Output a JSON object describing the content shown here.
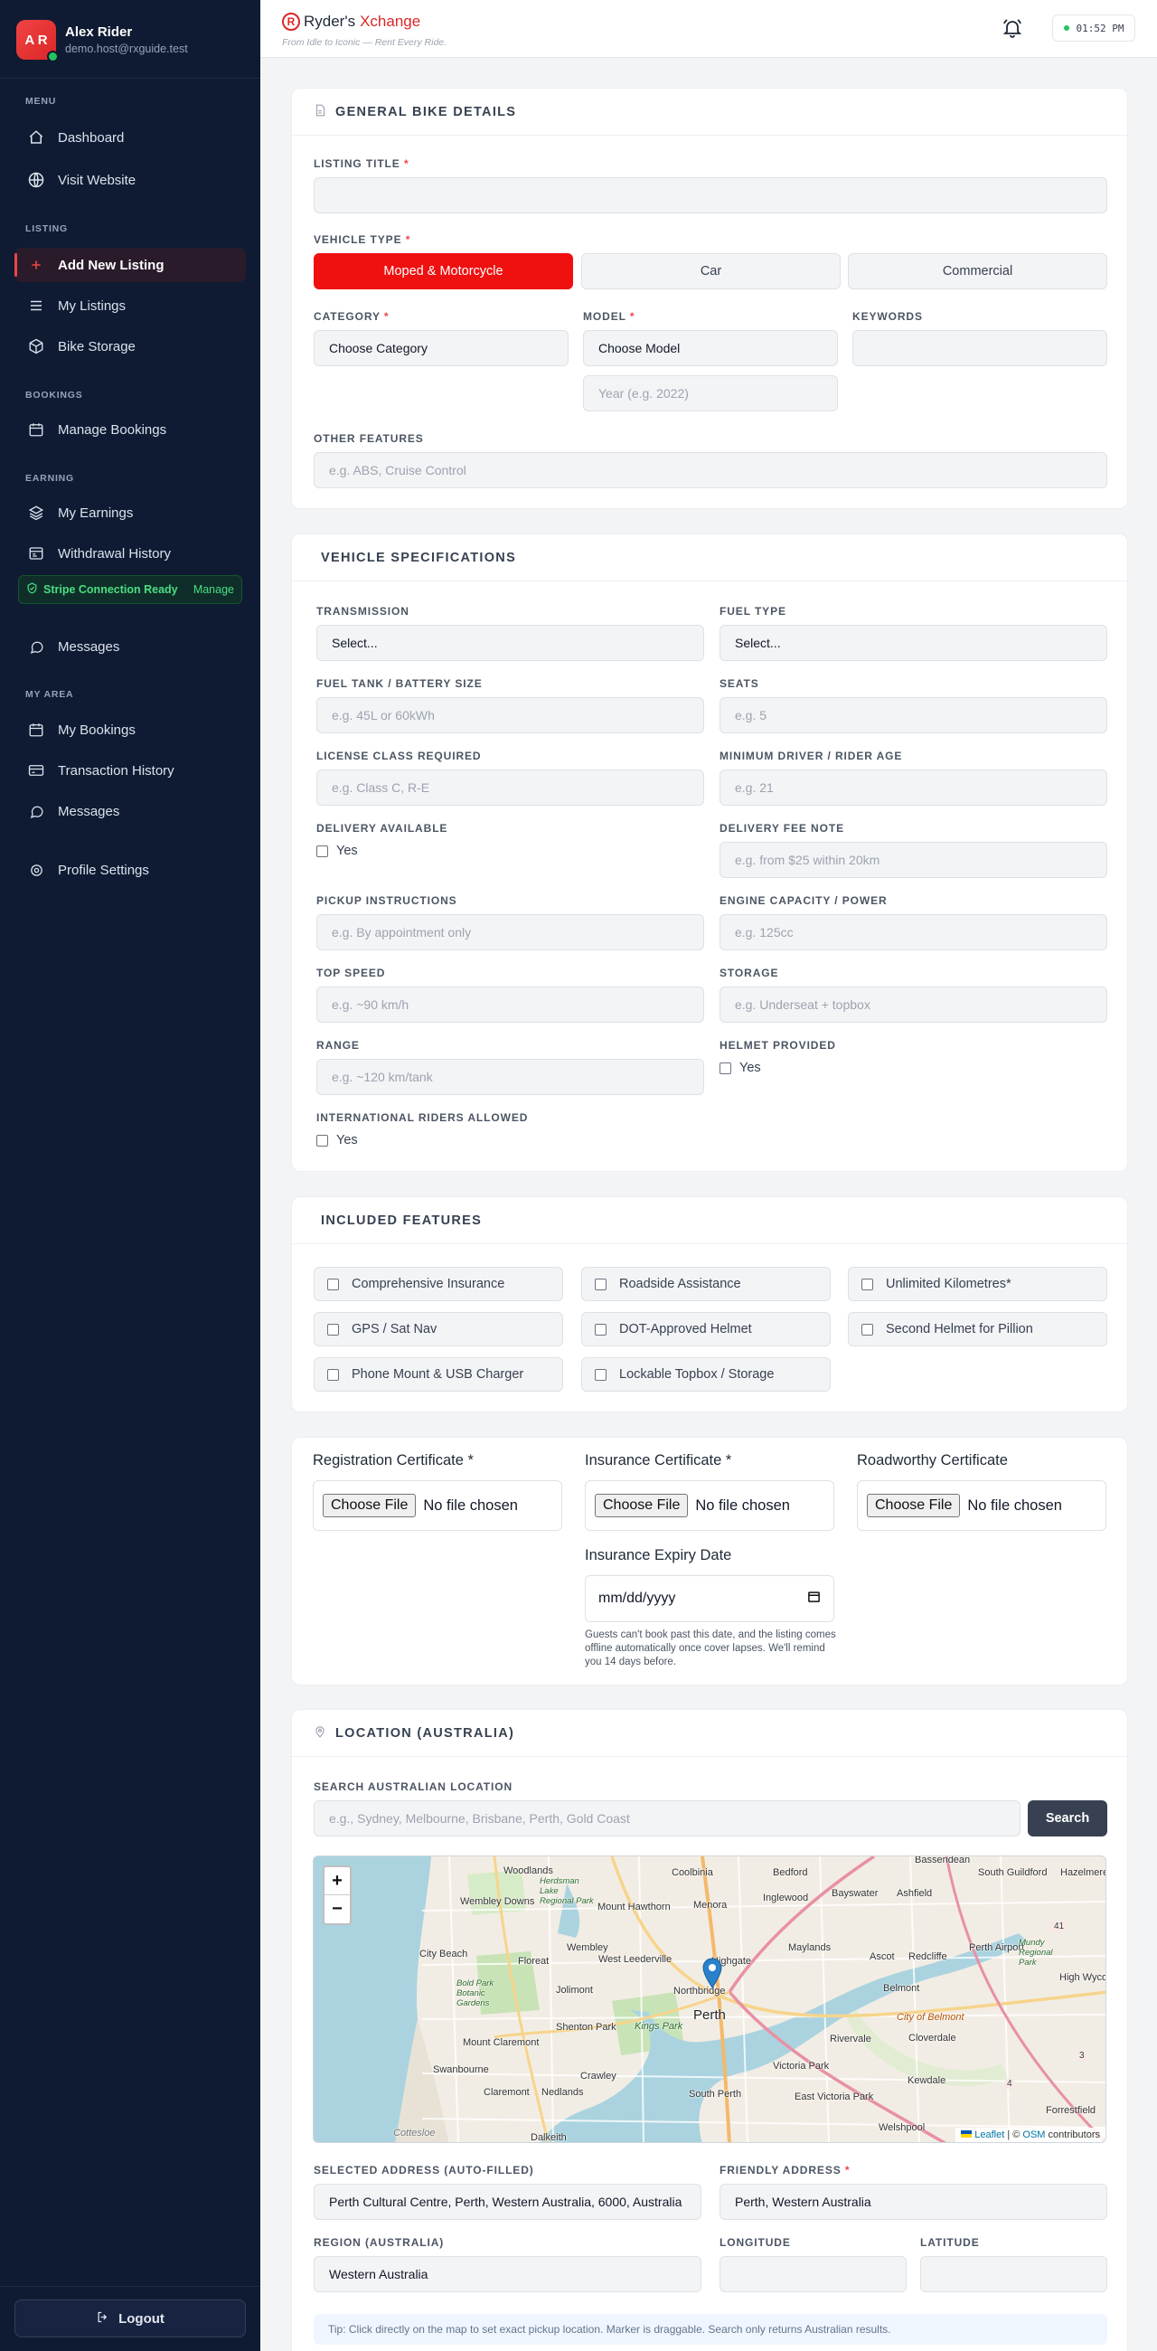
{
  "sidebar": {
    "user": {
      "initials": "A R",
      "name": "Alex Rider",
      "email": "demo.host@rxguide.test"
    },
    "sections": {
      "menu": "MENU",
      "listing": "LISTING",
      "bookings": "BOOKINGS",
      "earning": "EARNING",
      "my_area": "MY AREA"
    },
    "items": {
      "dashboard": "Dashboard",
      "visit_website": "Visit Website",
      "add_new_listing": "Add New Listing",
      "my_listings": "My Listings",
      "bike_storage": "Bike Storage",
      "manage_bookings": "Manage Bookings",
      "my_earnings": "My Earnings",
      "withdrawal_history": "Withdrawal History",
      "messages": "Messages",
      "my_bookings": "My Bookings",
      "transaction_history": "Transaction History",
      "messages2": "Messages",
      "profile_settings": "Profile Settings"
    },
    "stripe": {
      "status": "Stripe Connection Ready",
      "manage": "Manage",
      "color": "#4ade80"
    },
    "logout": "Logout"
  },
  "topbar": {
    "brand_left": "Ryder's",
    "brand_right": "Xchange",
    "brand_mark": "R",
    "tagline": "From Idle to Iconic — Rent Every Ride.",
    "clock": "01:52 PM"
  },
  "general": {
    "title": "GENERAL BIKE DETAILS",
    "listing_title_label": "LISTING TITLE",
    "vehicle_type_label": "VEHICLE TYPE",
    "vehicle_types": [
      "Moped & Motorcycle",
      "Car",
      "Commercial"
    ],
    "selected_vehicle_type": "Moped & Motorcycle",
    "category_label": "CATEGORY",
    "category_value": "Choose Category",
    "model_label": "MODEL",
    "model_value": "Choose Model",
    "year_placeholder": "Year (e.g. 2022)",
    "keywords_label": "KEYWORDS",
    "other_features_label": "OTHER FEATURES",
    "other_features_placeholder": "e.g. ABS, Cruise Control",
    "required_mark": "*"
  },
  "specs": {
    "title": "VEHICLE SPECIFICATIONS",
    "transmission_label": "TRANSMISSION",
    "transmission_value": "Select...",
    "fuel_type_label": "FUEL TYPE",
    "fuel_type_value": "Select...",
    "tank_label": "FUEL TANK / BATTERY SIZE",
    "tank_placeholder": "e.g. 45L or 60kWh",
    "seats_label": "SEATS",
    "seats_placeholder": "e.g. 5",
    "license_label": "LICENSE CLASS REQUIRED",
    "license_placeholder": "e.g. Class C, R-E",
    "min_age_label": "MINIMUM DRIVER / RIDER AGE",
    "min_age_placeholder": "e.g. 21",
    "delivery_label": "DELIVERY AVAILABLE",
    "delivery_fee_label": "DELIVERY FEE NOTE",
    "delivery_fee_placeholder": "e.g. from $25 within 20km",
    "pickup_label": "PICKUP INSTRUCTIONS",
    "pickup_placeholder": "e.g. By appointment only",
    "engine_label": "ENGINE CAPACITY / POWER",
    "engine_placeholder": "e.g. 125cc",
    "top_speed_label": "TOP SPEED",
    "top_speed_placeholder": "e.g. ~90 km/h",
    "storage_label": "STORAGE",
    "storage_placeholder": "e.g. Underseat + topbox",
    "range_label": "RANGE",
    "range_placeholder": "e.g. ~120 km/tank",
    "helmet_label": "HELMET PROVIDED",
    "intl_label": "INTERNATIONAL RIDERS ALLOWED",
    "yes": "Yes"
  },
  "features": {
    "title": "INCLUDED FEATURES",
    "items": [
      "Comprehensive Insurance",
      "Roadside Assistance",
      "Unlimited Kilometres*",
      "GPS / Sat Nav",
      "DOT-Approved Helmet",
      "Second Helmet for Pillion",
      "Phone Mount & USB Charger",
      "Lockable Topbox / Storage"
    ]
  },
  "documents": {
    "registration_label": "Registration Certificate *",
    "insurance_label": "Insurance Certificate *",
    "roadworthy_label": "Roadworthy Certificate",
    "choose_file": "Choose File",
    "no_file": "No file chosen",
    "expiry_label": "Insurance Expiry Date",
    "expiry_placeholder": "mm/dd/yyyy",
    "expiry_hint": "Guests can't book past this date, and the listing comes offline automatically once cover lapses. We'll remind you 14 days before."
  },
  "location": {
    "title": "LOCATION (AUSTRALIA)",
    "search_label": "SEARCH AUSTRALIAN LOCATION",
    "search_placeholder": "e.g., Sydney, Melbourne, Brisbane, Perth, Gold Coast",
    "search_button": "Search",
    "map": {
      "zoom_in": "+",
      "zoom_out": "−",
      "attribution_leaflet": "Leaflet",
      "attribution_sep": " | © ",
      "attribution_osm": "OSM",
      "attribution_rest": " contributors",
      "places": [
        "Woodlands",
        "Coolbinia",
        "Bedford",
        "Bassendean",
        "South Guildford",
        "Hazelmere",
        "Wembley Downs",
        "Mount Hawthorn",
        "Menora",
        "Inglewood",
        "Bayswater",
        "Ashfield",
        "City Beach",
        "Floreat",
        "Wembley",
        "West Leederville",
        "Highgate",
        "Maylands",
        "Ascot",
        "Redcliffe",
        "Perth Airport",
        "High Wycombe",
        "Northbridge",
        "Belmont",
        "Jolimont",
        "Perth",
        "Mount Claremont",
        "Shenton Park",
        "Rivervale",
        "Cloverdale",
        "Swanbourne",
        "Crawley",
        "Victoria Park",
        "Kewdale",
        "Claremont",
        "Nedlands",
        "South Perth",
        "East Victoria Park",
        "Forrestfield",
        "Cottesloe",
        "Dalkeith",
        "Welshpool",
        "Bold Park Botanic Gardens",
        "Kings Park",
        "City of Belmont",
        "Mundy Regional Park",
        "Herdsman Lake Regional Park"
      ],
      "road_numbers": [
        "41",
        "3",
        "4"
      ]
    },
    "selected_address_label": "SELECTED ADDRESS (AUTO-FILLED)",
    "selected_address": "Perth Cultural Centre, Perth, Western Australia, 6000, Australia",
    "friendly_label": "FRIENDLY ADDRESS",
    "friendly_value": "Perth, Western Australia",
    "region_label": "REGION (AUSTRALIA)",
    "region_value": "Western Australia",
    "longitude_label": "LONGITUDE",
    "latitude_label": "LATITUDE",
    "tip": "Tip: Click directly on the map to set exact pickup location. Marker is draggable. Search only returns Australian results."
  },
  "colors": {
    "accent": "#ef1010",
    "sidebar": "#0f1b33",
    "active_bg": "#2a1b2b"
  }
}
